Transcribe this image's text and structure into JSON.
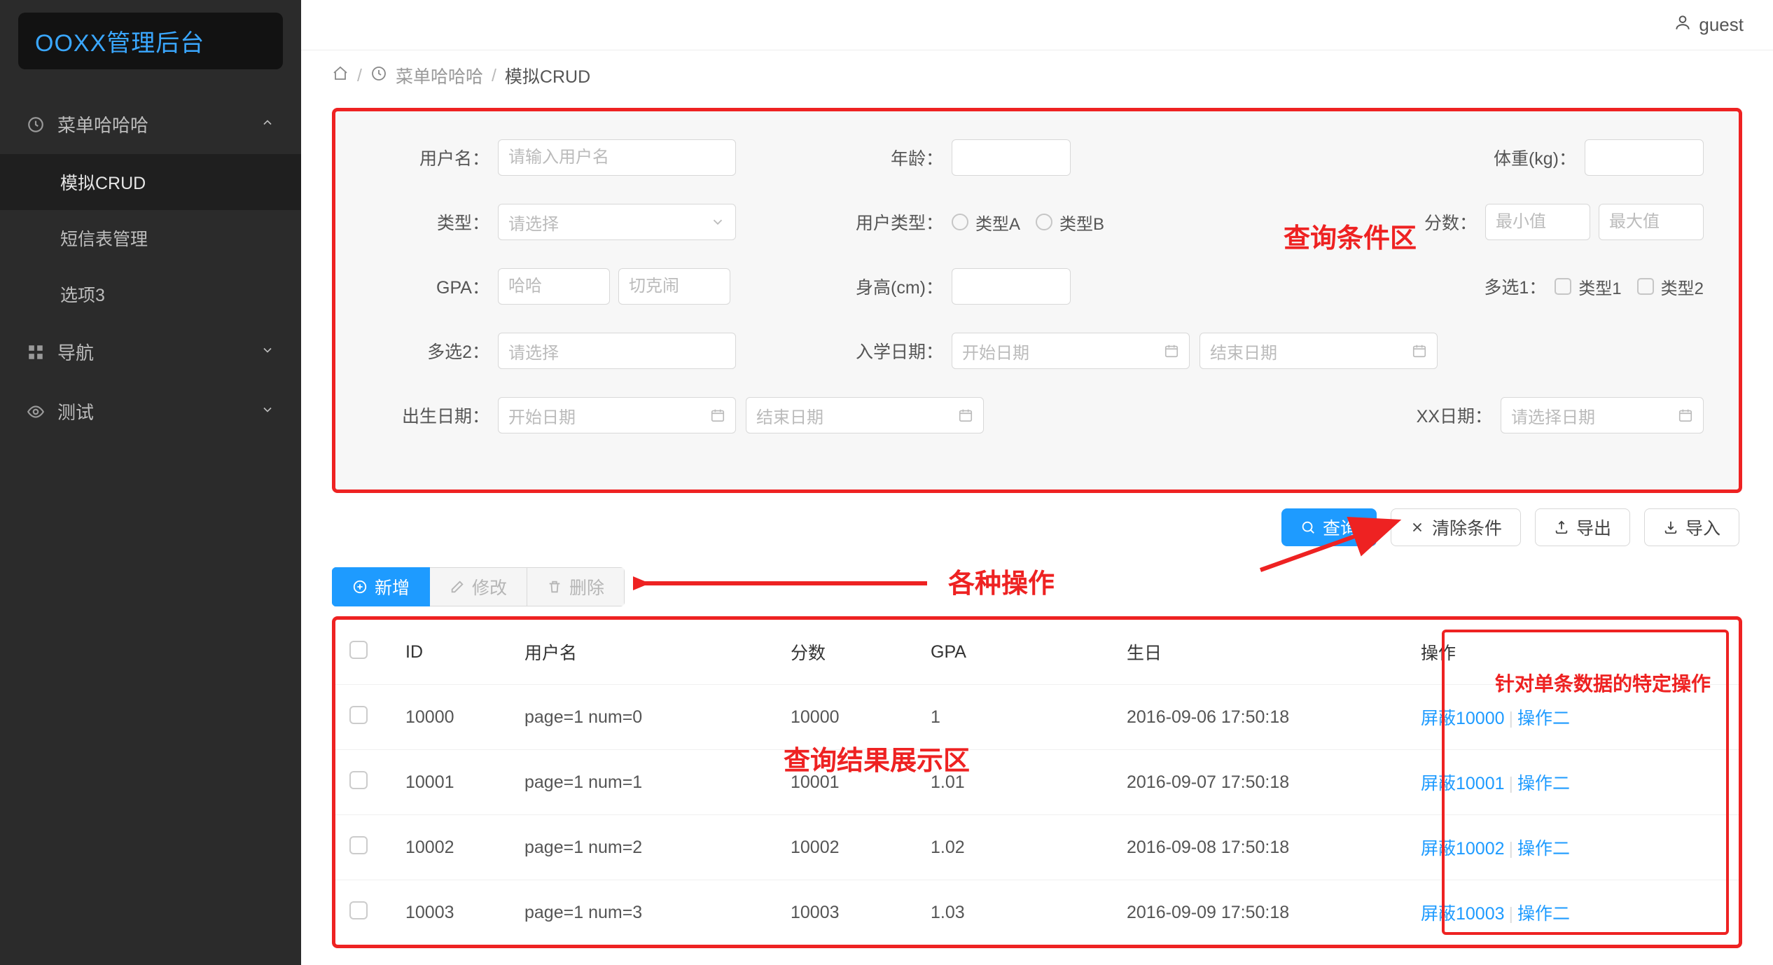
{
  "brand": "OOXX管理后台",
  "user": {
    "name": "guest"
  },
  "sidebar": {
    "menu1": {
      "label": "菜单哈哈哈",
      "expanded": true,
      "items": [
        "模拟CRUD",
        "短信表管理",
        "选项3"
      ]
    },
    "menu2": {
      "label": "导航"
    },
    "menu3": {
      "label": "测试"
    }
  },
  "breadcrumb": {
    "menu": "菜单哈哈哈",
    "page": "模拟CRUD"
  },
  "query": {
    "username": {
      "label": "用户名：",
      "placeholder": "请输入用户名"
    },
    "age": {
      "label": "年龄："
    },
    "weight": {
      "label": "体重(kg)："
    },
    "type": {
      "label": "类型：",
      "placeholder": "请选择"
    },
    "usertype": {
      "label": "用户类型：",
      "optA": "类型A",
      "optB": "类型B"
    },
    "score": {
      "label": "分数：",
      "min_ph": "最小值",
      "max_ph": "最大值"
    },
    "gpa": {
      "label": "GPA：",
      "ph1": "哈哈",
      "ph2": "切克闹"
    },
    "height": {
      "label": "身高(cm)："
    },
    "multi1": {
      "label": "多选1：",
      "opt1": "类型1",
      "opt2": "类型2"
    },
    "multi2": {
      "label": "多选2：",
      "placeholder": "请选择"
    },
    "enroll": {
      "label": "入学日期：",
      "start_ph": "开始日期",
      "end_ph": "结束日期"
    },
    "birth": {
      "label": "出生日期：",
      "start_ph": "开始日期",
      "end_ph": "结束日期"
    },
    "xxdate": {
      "label": "XX日期：",
      "placeholder": "请选择日期"
    }
  },
  "annotations": {
    "query_area": "查询条件区",
    "ops_area": "各种操作",
    "result_area": "查询结果展示区",
    "row_ops": "针对单条数据的特定操作"
  },
  "toolbar": {
    "search": "查询",
    "clear": "清除条件",
    "export": "导出",
    "import": "导入"
  },
  "crud": {
    "add": "新增",
    "edit": "修改",
    "del": "删除"
  },
  "table": {
    "cols": {
      "id": "ID",
      "user": "用户名",
      "score": "分数",
      "gpa": "GPA",
      "birth": "生日",
      "ops": "操作"
    },
    "op2": "操作二",
    "rows": [
      {
        "id": "10000",
        "user": "page=1 num=0",
        "score": "10000",
        "gpa": "1",
        "birth": "2016-09-06 17:50:18",
        "op1": "屏蔽10000"
      },
      {
        "id": "10001",
        "user": "page=1 num=1",
        "score": "10001",
        "gpa": "1.01",
        "birth": "2016-09-07 17:50:18",
        "op1": "屏蔽10001"
      },
      {
        "id": "10002",
        "user": "page=1 num=2",
        "score": "10002",
        "gpa": "1.02",
        "birth": "2016-09-08 17:50:18",
        "op1": "屏蔽10002"
      },
      {
        "id": "10003",
        "user": "page=1 num=3",
        "score": "10003",
        "gpa": "1.03",
        "birth": "2016-09-09 17:50:18",
        "op1": "屏蔽10003"
      }
    ]
  }
}
